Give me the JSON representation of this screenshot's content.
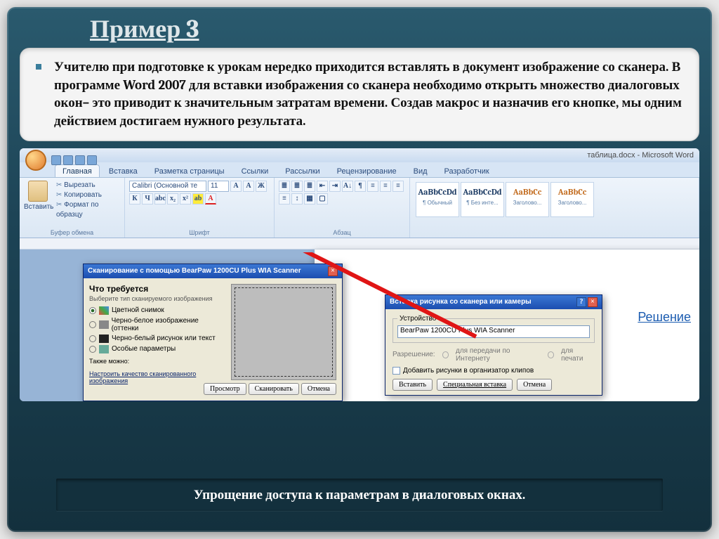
{
  "slide": {
    "title": "Пример 3",
    "paragraph": "Учителю при подготовке к урокам нередко приходится вставлять в документ изображение со сканера. В программе Word 2007 для вставки изображения со сканера необходимо открыть множество диалоговых окон– это приводит к значительным затратам времени. Создав макрос и назначив его кнопке, мы одним действием достигаем нужного результата.",
    "footer": "Упрощение доступа к параметрам в диалоговых окнах.",
    "solution_link": "Решение"
  },
  "word": {
    "doc_title": "таблица.docx - Microsoft Word",
    "tabs": [
      "Главная",
      "Вставка",
      "Разметка страницы",
      "Ссылки",
      "Рассылки",
      "Рецензирование",
      "Вид",
      "Разработчик"
    ],
    "clipboard": {
      "paste": "Вставить",
      "cut": "Вырезать",
      "copy": "Копировать",
      "format": "Формат по образцу",
      "label": "Буфер обмена"
    },
    "font": {
      "name": "Calibri (Основной те",
      "size": "11",
      "label": "Шрифт"
    },
    "paragraph_label": "Абзац",
    "styles": {
      "preview": "AaBbCcDd",
      "preview2": "AaBbCc",
      "items": [
        "¶ Обычный",
        "¶ Без инте...",
        "Заголово...",
        "Заголово..."
      ]
    }
  },
  "scan_dialog": {
    "title": "Сканирование с помощью BearPaw 1200CU Plus WIA Scanner",
    "heading": "Что требуется",
    "sub": "Выберите тип сканируемого изображения",
    "opt_color": "Цветной снимок",
    "opt_gray": "Черно-белое изображение (оттенки",
    "opt_bw": "Черно-белый рисунок или текст",
    "opt_custom": "Особые параметры",
    "also": "Также можно:",
    "link": "Настроить качество сканированного изображения",
    "btn_preview": "Просмотр",
    "btn_scan": "Сканировать",
    "btn_cancel": "Отмена"
  },
  "insert_dialog": {
    "title": "Вставка рисунка со сканера или камеры",
    "device_label": "Устройство",
    "device": "BearPaw 1200CU Plus WIA Scanner",
    "res_label": "Разрешение:",
    "res_web": "для передачи по Интернету",
    "res_print": "для печати",
    "add_clips": "Добавить рисунки в организатор клипов",
    "btn_insert": "Вставить",
    "btn_special": "Специальная вставка",
    "btn_cancel": "Отмена"
  }
}
